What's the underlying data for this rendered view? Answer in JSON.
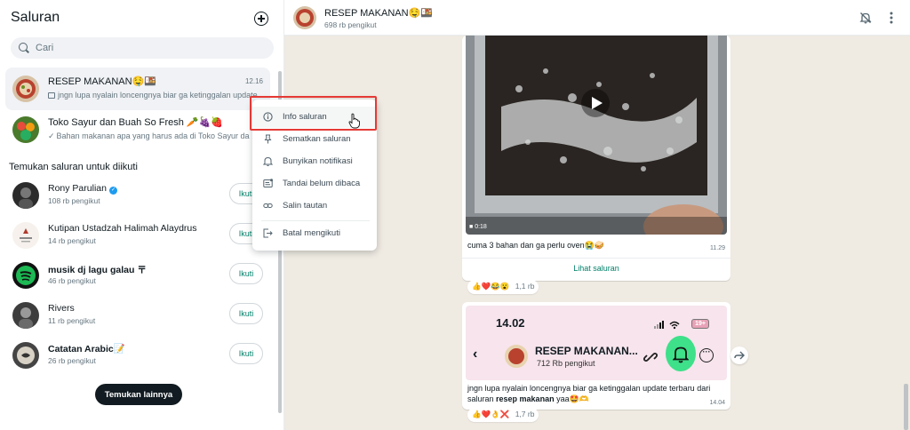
{
  "sidebar": {
    "title": "Saluran",
    "new_channel_icon": "plus-circle-icon",
    "search_placeholder": "Cari",
    "channels": [
      {
        "name": "RESEP MAKANAN🤤🍱",
        "time": "12.16",
        "preview": "jngn lupa nyalain loncengnya biar ga ketinggalan update"
      },
      {
        "name": "Toko Sayur dan Buah So Fresh 🥕🍇🍓",
        "time": "",
        "preview": "Bahan makanan apa yang harus ada di Toko Sayur da"
      }
    ],
    "discover_title": "Temukan saluran untuk diikuti",
    "discover": [
      {
        "name": "Rony Parulian",
        "followers": "108 rb pengikut",
        "button": "Ikuti"
      },
      {
        "name": "Kutipan Ustadzah Halimah Alaydrus",
        "followers": "14 rb pengikut",
        "button": "Ikuti"
      },
      {
        "name": "musik dj lagu galau 〒",
        "followers": "46 rb pengikut",
        "button": "Ikuti"
      },
      {
        "name": "Rivers",
        "followers": "11 rb pengikut",
        "button": "Ikuti"
      },
      {
        "name": "Catatan Arabic📝",
        "followers": "26 rb pengikut",
        "button": "Ikuti"
      }
    ],
    "find_more": "Temukan lainnya"
  },
  "context_menu": {
    "items": [
      {
        "label": "Info saluran",
        "icon": "info-icon"
      },
      {
        "label": "Sematkan saluran",
        "icon": "pin-icon"
      },
      {
        "label": "Bunyikan notifikasi",
        "icon": "bell-icon"
      },
      {
        "label": "Tandai belum dibaca",
        "icon": "mark-unread-icon"
      },
      {
        "label": "Salin tautan",
        "icon": "link-icon"
      },
      {
        "label": "Batal mengikuti",
        "icon": "exit-icon"
      }
    ]
  },
  "channel_header": {
    "title": "RESEP MAKANAN🤤🍱",
    "followers": "698 rb pengikut"
  },
  "messages": [
    {
      "video_duration": "0:18",
      "text": "cuma 3 bahan dan ga perlu oven😭🥪",
      "time": "11.29",
      "link_label": "Lihat saluran",
      "reactions": "👍❤️😂😮",
      "reaction_count": "1,1 rb"
    },
    {
      "screenshot_time": "14.02",
      "screenshot_battery": "19+",
      "screenshot_channel": "RESEP MAKANAN...",
      "screenshot_followers": "712 Rb pengikut",
      "text_plain": "jngn lupa nyalain loncengnya biar ga ketinggalan update terbaru dari saluran ",
      "text_bold": "resep makanan",
      "text_end": " yaa🤩🫶",
      "time": "14.04",
      "reactions": "👍❤️👌❌",
      "reaction_count": "1,7 rb"
    }
  ],
  "colors": {
    "accent_green": "#008069",
    "highlight_red": "#e53935",
    "chat_bg": "#efeae2"
  }
}
